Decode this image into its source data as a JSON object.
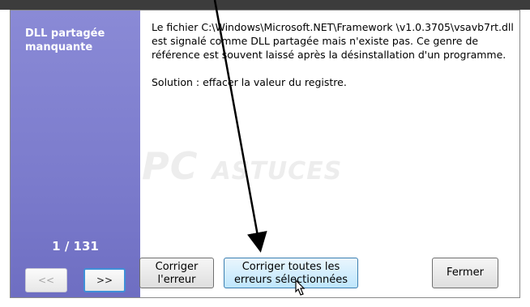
{
  "sidebar": {
    "title": "DLL partagée manquante",
    "counter": "1 / 131",
    "prev_label": "<<",
    "next_label": ">>"
  },
  "content": {
    "description": "Le fichier C:\\Windows\\Microsoft.NET\\Framework \\v1.0.3705\\vsavb7rt.dll est signalé comme DLL partagée mais n'existe pas. Ce genre de référence est souvent laissé après la désinstallation d'un programme.",
    "solution": "Solution : effacer la valeur du registre."
  },
  "watermark": {
    "text_big": "PC",
    "text_small": "ASTUCES"
  },
  "buttons": {
    "fix_one_line1": "Corriger",
    "fix_one_line2": "l'erreur",
    "fix_all_line1": "Corriger toutes les",
    "fix_all_line2": "erreurs sélectionnées",
    "close_label": "Fermer"
  },
  "colors": {
    "sidebar": "#7b7bcc",
    "selected_button": "#bee6fd",
    "arrow": "#000000"
  }
}
